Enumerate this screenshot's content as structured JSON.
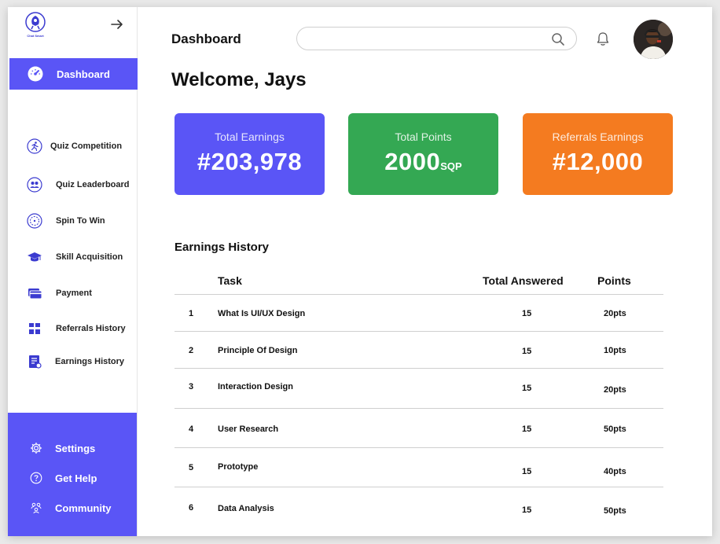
{
  "app": {
    "logo_text": "Chat Smart"
  },
  "sidebar": {
    "active_item": {
      "label": "Dashboard",
      "icon": "dashboard-gauge-icon"
    },
    "items": [
      {
        "label": "Quiz Competition",
        "icon": "running-person-icon"
      },
      {
        "label": "Quiz Leaderboard",
        "icon": "people-icon"
      },
      {
        "label": "Spin To Win",
        "icon": "spinner-wheel-icon"
      },
      {
        "label": "Skill Acquisition",
        "icon": "graduation-cap-icon"
      },
      {
        "label": "Payment",
        "icon": "card-icon"
      },
      {
        "label": "Referrals History",
        "icon": "grid-blocks-icon"
      },
      {
        "label": "Earnings History",
        "icon": "document-list-icon"
      }
    ],
    "bottom_items": [
      {
        "label": "Settings",
        "icon": "gear-icon"
      },
      {
        "label": "Get Help",
        "icon": "question-icon"
      },
      {
        "label": "Community",
        "icon": "community-icon"
      }
    ],
    "accent_color": "#5a55f6"
  },
  "header": {
    "title": "Dashboard",
    "search_value": "",
    "search_placeholder": ""
  },
  "welcome": "Welcome, Jays",
  "cards": [
    {
      "title": "Total Earnings",
      "value": "#203,978",
      "unit": "",
      "color": "#5a55f6"
    },
    {
      "title": "Total Points",
      "value": "2000",
      "unit": "SQP",
      "color": "#34a853"
    },
    {
      "title": "Referrals Earnings",
      "value": "#12,000",
      "unit": "",
      "color": "#f47b20"
    }
  ],
  "history": {
    "title": "Earnings History",
    "columns": {
      "task": "Task",
      "answered": "Total Answered",
      "points": "Points"
    },
    "rows": [
      {
        "num": "1",
        "task": "What Is UI/UX Design",
        "answered": "15",
        "points": "20pts"
      },
      {
        "num": "2",
        "task": "Principle Of Design",
        "answered": "15",
        "points": "10pts"
      },
      {
        "num": "3",
        "task": "Interaction Design",
        "answered": "15",
        "points": "20pts"
      },
      {
        "num": "4",
        "task": "User Research",
        "answered": "15",
        "points": "50pts"
      },
      {
        "num": "5",
        "task": "Prototype",
        "answered": "15",
        "points": "40pts"
      },
      {
        "num": "6",
        "task": "Data Analysis",
        "answered": "15",
        "points": "50pts"
      }
    ]
  }
}
